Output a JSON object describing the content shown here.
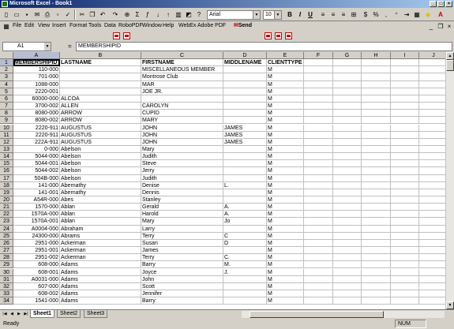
{
  "window": {
    "title": "Microsoft Excel - Book1"
  },
  "toolbar": {
    "font_name": "Arial",
    "font_size": "10",
    "bold": "B",
    "italic": "I",
    "underline": "U",
    "sum": "Σ",
    "currency": "$",
    "percent": "%",
    "comma": ",",
    "icons": [
      "new-icon",
      "open-icon",
      "save-icon",
      "mail-icon",
      "print-icon",
      "preview-icon",
      "spelling-icon",
      "cut-icon",
      "copy-icon",
      "paste-icon",
      "undo-icon",
      "hyperlink-icon",
      "sort-asc-icon",
      "sort-desc-icon",
      "chart-wizard-icon",
      "zoom-icon",
      "help-icon"
    ]
  },
  "menu": {
    "items": [
      "File",
      "Edit",
      "View",
      "Insert",
      "Format",
      "Tools",
      "Data",
      "RoboPDF",
      "Window",
      "Help",
      "WebEx",
      "Adobe PDF"
    ],
    "send_label": "Send"
  },
  "formula_bar": {
    "name_box": "A1",
    "equals": "=",
    "content": "MEMBERSHIPID"
  },
  "grid": {
    "columns": [
      "A",
      "B",
      "C",
      "D",
      "E",
      "F",
      "G",
      "H",
      "I",
      "J"
    ],
    "selected_col": "A",
    "headers": [
      "MEMBERSHIPID",
      "LASTNAME",
      "FIRSTNAME",
      "MIDDLENAME",
      "CLIENTTYPE"
    ],
    "rows": [
      [
        "110-000",
        "",
        "MISCELLANEOUS MEMBER",
        "",
        "M"
      ],
      [
        "701-000",
        "",
        "Montrose Club",
        "",
        "M"
      ],
      [
        "1088-000",
        "",
        "MAR",
        "",
        "M"
      ],
      [
        "2220-001",
        "",
        "JOE JR.",
        "",
        "M"
      ],
      [
        "60000-000",
        "ALCOA",
        "",
        "",
        "M"
      ],
      [
        "3700-002",
        "ALLEN",
        "CAROLYN",
        "",
        "M"
      ],
      [
        "8080-000",
        "ARROW",
        "CUPID",
        "",
        "M"
      ],
      [
        "8080-002",
        "ARROW",
        "MARY",
        "",
        "M"
      ],
      [
        "2220-911",
        "AUGUSTUS",
        "JOHN",
        "JAMES",
        "M"
      ],
      [
        "2220-911",
        "AUGUSTUS",
        "JOHN",
        "JAMES",
        "M"
      ],
      [
        "222A-911",
        "AUGUSTUS",
        "JOHN",
        "JAMES",
        "M"
      ],
      [
        "0-000",
        "Abelson",
        "Mary",
        "",
        "M"
      ],
      [
        "5044-000",
        "Abelson",
        "Judith",
        "",
        "M"
      ],
      [
        "5044-001",
        "Abelson",
        "Steve",
        "",
        "M"
      ],
      [
        "5044-002",
        "Abelson",
        "Jerry",
        "",
        "M"
      ],
      [
        "504B-000",
        "Abelson",
        "Judith",
        "",
        "M"
      ],
      [
        "141-000",
        "Abernathy",
        "Denise",
        "L.",
        "M"
      ],
      [
        "141-001",
        "Abernathy",
        "Dennis",
        "",
        "M"
      ],
      [
        "A54R-000",
        "Abes",
        "Stanley",
        "",
        "M"
      ],
      [
        "1570-000",
        "Ablan",
        "Gerald",
        "A.",
        "M"
      ],
      [
        "1570A-000",
        "Ablan",
        "Harold",
        "A.",
        "M"
      ],
      [
        "1570A-001",
        "Ablan",
        "Mary",
        "Jo",
        "M"
      ],
      [
        "A0004-000",
        "Abraham",
        "Larry",
        "",
        "M"
      ],
      [
        "24300-000",
        "Abrams",
        "Terry",
        "C",
        "M"
      ],
      [
        "2951-000",
        "Ackerman",
        "Susan",
        "D",
        "M"
      ],
      [
        "2951-001",
        "Ackerman",
        "James",
        "",
        "M"
      ],
      [
        "2951-002",
        "Ackerman",
        "Terry",
        "C.",
        "M"
      ],
      [
        "608-000",
        "Adams",
        "Barry",
        "M.",
        "M"
      ],
      [
        "608-001",
        "Adams",
        "Joyce",
        "J.",
        "M"
      ],
      [
        "A0031-000",
        "Adams",
        "John",
        "",
        "M"
      ],
      [
        "607-000",
        "Adams",
        "Scott",
        "",
        "M"
      ],
      [
        "608-002",
        "Adams",
        "Jennifer",
        "",
        "M"
      ],
      [
        "1541-000",
        "Adams",
        "Barry",
        "",
        "M"
      ]
    ]
  },
  "sheets": {
    "tabs": [
      "Sheet1",
      "Sheet2",
      "Sheet3"
    ],
    "active": "Sheet1"
  },
  "status": {
    "text": "Ready",
    "num": "NUM"
  }
}
